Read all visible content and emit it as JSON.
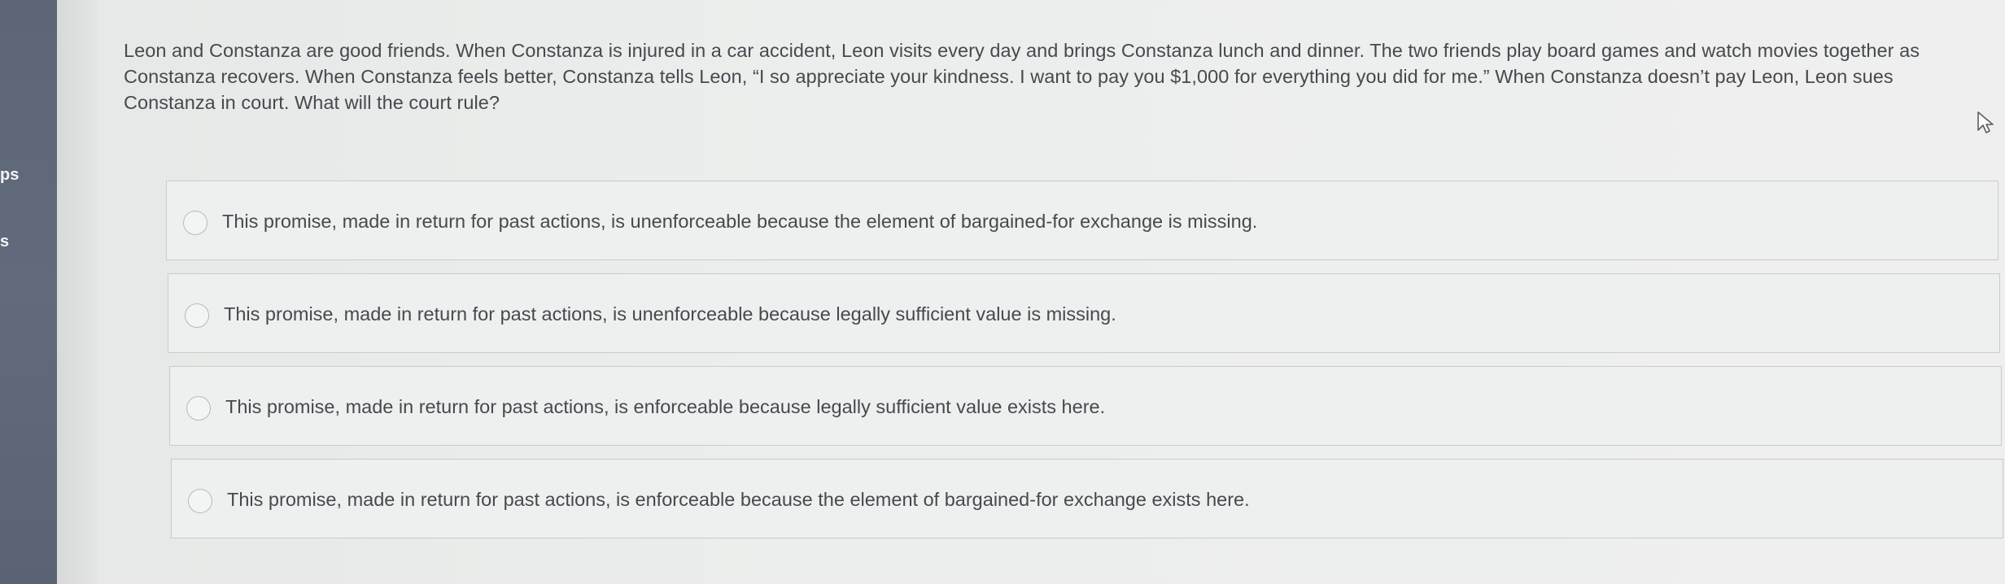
{
  "sidebar": {
    "labels": [
      "ps",
      "s"
    ]
  },
  "question": {
    "text": "Leon and Constanza are good friends. When Constanza is injured in a car accident, Leon visits every day and brings Constanza lunch and dinner. The two friends play board games and watch movies together as Constanza recovers. When Constanza feels better, Constanza tells Leon, “I so appreciate your kindness. I want to pay you $1,000 for everything you did for me.” When Constanza doesn’t pay Leon, Leon sues Constanza in court. What will the court rule?"
  },
  "options": [
    {
      "label": "This promise, made in return for past actions, is unenforceable because the element of bargained-for exchange is missing."
    },
    {
      "label": "This promise, made in return for past actions, is unenforceable because legally sufficient value is missing."
    },
    {
      "label": "This promise, made in return for past actions, is enforceable because legally sufficient value exists here."
    },
    {
      "label": "This promise, made in return for past actions, is enforceable because the element of bargained-for exchange exists here."
    }
  ],
  "icons": {
    "cursor": "mouse-pointer-icon",
    "radio": "radio-unchecked-icon"
  }
}
